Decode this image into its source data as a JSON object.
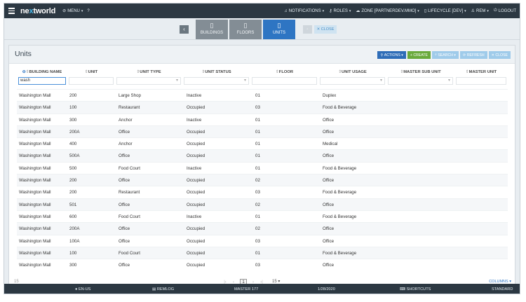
{
  "topbar": {
    "logo_pre": "ne",
    "logo_x": "x",
    "logo_post": "tworld",
    "menu": "MENU",
    "notifications": "NOTIFICATIONS",
    "roles": "ROLES",
    "zone": "ZONE [PARTNERDEV.MMO]",
    "lifecycle": "LIFECYCLE [DEV]",
    "user": "REM",
    "logout": "LOGOUT"
  },
  "nav": {
    "back": "‹",
    "tabs": [
      {
        "label": "BUILDINGS",
        "icon": "document-icon"
      },
      {
        "label": "FLOORS",
        "icon": "document-icon"
      },
      {
        "label": "UNITS",
        "icon": "document-icon"
      }
    ],
    "close": "✕ CLOSE"
  },
  "panel": {
    "title": "Units",
    "buttons": {
      "actions": "ACTIONS",
      "create": "+ CREATE",
      "search": "SEARCH",
      "refresh": "REFRESH",
      "close": "CLOSE"
    }
  },
  "grid": {
    "columns": [
      "BUILDING NAME",
      "UNIT",
      "UNIT TYPE",
      "UNIT STATUS",
      "FLOOR",
      "UNIT USAGE",
      "MASTER SUB UNIT",
      "MASTER UNIT"
    ],
    "filter_building": "wash",
    "rows": [
      [
        "Washington Mall",
        "200",
        "Large Shop",
        "Inactive",
        "01",
        "Duplex"
      ],
      [
        "Washington Mall",
        "100",
        "Restaurant",
        "Occupied",
        "03",
        "Food & Beverage"
      ],
      [
        "Washington Mall",
        "300",
        "Anchor",
        "Inactive",
        "01",
        "Office"
      ],
      [
        "Washington Mall",
        "200A",
        "Office",
        "Occupied",
        "01",
        "Office"
      ],
      [
        "Washington Mall",
        "400",
        "Anchor",
        "Occupied",
        "01",
        "Medical"
      ],
      [
        "Washington Mall",
        "500A",
        "Office",
        "Occupied",
        "01",
        "Office"
      ],
      [
        "Washington Mall",
        "500",
        "Food Court",
        "Inactive",
        "01",
        "Food & Beverage"
      ],
      [
        "Washington Mall",
        "200",
        "Office",
        "Occupied",
        "02",
        "Office"
      ],
      [
        "Washington Mall",
        "200",
        "Restaurant",
        "Occupied",
        "03",
        "Food & Beverage"
      ],
      [
        "Washington Mall",
        "501",
        "Office",
        "Occupied",
        "02",
        "Office"
      ],
      [
        "Washington Mall",
        "600",
        "Food Court",
        "Inactive",
        "01",
        "Food & Beverage"
      ],
      [
        "Washington Mall",
        "200A",
        "Office",
        "Occupied",
        "02",
        "Office"
      ],
      [
        "Washington Mall",
        "100A",
        "Office",
        "Occupied",
        "03",
        "Office"
      ],
      [
        "Washington Mall",
        "100",
        "Food Court",
        "Occupied",
        "01",
        "Food & Beverage"
      ],
      [
        "Washington Mall",
        "300",
        "Office",
        "Occupied",
        "03",
        "Office"
      ]
    ]
  },
  "pager": {
    "count": "15",
    "current_page": "1",
    "page_size": "15",
    "columns_link": "COLUMNS"
  },
  "footer": {
    "locale": "EN-US",
    "log": "REMLOG",
    "master": "MASTER 177",
    "date": "1/28/2020",
    "shortcuts": "SHORTCUTS",
    "mode": "STANDARD"
  }
}
